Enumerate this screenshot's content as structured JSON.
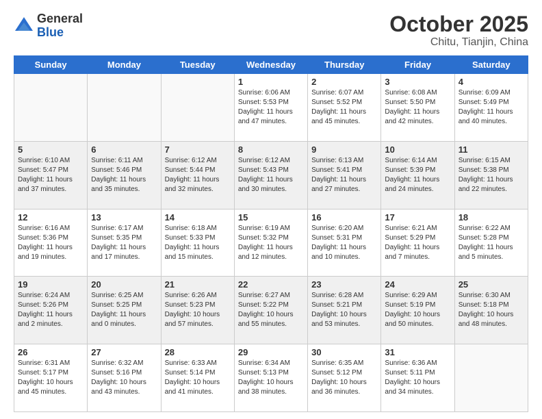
{
  "header": {
    "logo_general": "General",
    "logo_blue": "Blue",
    "month": "October 2025",
    "location": "Chitu, Tianjin, China"
  },
  "weekdays": [
    "Sunday",
    "Monday",
    "Tuesday",
    "Wednesday",
    "Thursday",
    "Friday",
    "Saturday"
  ],
  "weeks": [
    [
      {
        "day": "",
        "info": ""
      },
      {
        "day": "",
        "info": ""
      },
      {
        "day": "",
        "info": ""
      },
      {
        "day": "1",
        "info": "Sunrise: 6:06 AM\nSunset: 5:53 PM\nDaylight: 11 hours\nand 47 minutes."
      },
      {
        "day": "2",
        "info": "Sunrise: 6:07 AM\nSunset: 5:52 PM\nDaylight: 11 hours\nand 45 minutes."
      },
      {
        "day": "3",
        "info": "Sunrise: 6:08 AM\nSunset: 5:50 PM\nDaylight: 11 hours\nand 42 minutes."
      },
      {
        "day": "4",
        "info": "Sunrise: 6:09 AM\nSunset: 5:49 PM\nDaylight: 11 hours\nand 40 minutes."
      }
    ],
    [
      {
        "day": "5",
        "info": "Sunrise: 6:10 AM\nSunset: 5:47 PM\nDaylight: 11 hours\nand 37 minutes."
      },
      {
        "day": "6",
        "info": "Sunrise: 6:11 AM\nSunset: 5:46 PM\nDaylight: 11 hours\nand 35 minutes."
      },
      {
        "day": "7",
        "info": "Sunrise: 6:12 AM\nSunset: 5:44 PM\nDaylight: 11 hours\nand 32 minutes."
      },
      {
        "day": "8",
        "info": "Sunrise: 6:12 AM\nSunset: 5:43 PM\nDaylight: 11 hours\nand 30 minutes."
      },
      {
        "day": "9",
        "info": "Sunrise: 6:13 AM\nSunset: 5:41 PM\nDaylight: 11 hours\nand 27 minutes."
      },
      {
        "day": "10",
        "info": "Sunrise: 6:14 AM\nSunset: 5:39 PM\nDaylight: 11 hours\nand 24 minutes."
      },
      {
        "day": "11",
        "info": "Sunrise: 6:15 AM\nSunset: 5:38 PM\nDaylight: 11 hours\nand 22 minutes."
      }
    ],
    [
      {
        "day": "12",
        "info": "Sunrise: 6:16 AM\nSunset: 5:36 PM\nDaylight: 11 hours\nand 19 minutes."
      },
      {
        "day": "13",
        "info": "Sunrise: 6:17 AM\nSunset: 5:35 PM\nDaylight: 11 hours\nand 17 minutes."
      },
      {
        "day": "14",
        "info": "Sunrise: 6:18 AM\nSunset: 5:33 PM\nDaylight: 11 hours\nand 15 minutes."
      },
      {
        "day": "15",
        "info": "Sunrise: 6:19 AM\nSunset: 5:32 PM\nDaylight: 11 hours\nand 12 minutes."
      },
      {
        "day": "16",
        "info": "Sunrise: 6:20 AM\nSunset: 5:31 PM\nDaylight: 11 hours\nand 10 minutes."
      },
      {
        "day": "17",
        "info": "Sunrise: 6:21 AM\nSunset: 5:29 PM\nDaylight: 11 hours\nand 7 minutes."
      },
      {
        "day": "18",
        "info": "Sunrise: 6:22 AM\nSunset: 5:28 PM\nDaylight: 11 hours\nand 5 minutes."
      }
    ],
    [
      {
        "day": "19",
        "info": "Sunrise: 6:24 AM\nSunset: 5:26 PM\nDaylight: 11 hours\nand 2 minutes."
      },
      {
        "day": "20",
        "info": "Sunrise: 6:25 AM\nSunset: 5:25 PM\nDaylight: 11 hours\nand 0 minutes."
      },
      {
        "day": "21",
        "info": "Sunrise: 6:26 AM\nSunset: 5:23 PM\nDaylight: 10 hours\nand 57 minutes."
      },
      {
        "day": "22",
        "info": "Sunrise: 6:27 AM\nSunset: 5:22 PM\nDaylight: 10 hours\nand 55 minutes."
      },
      {
        "day": "23",
        "info": "Sunrise: 6:28 AM\nSunset: 5:21 PM\nDaylight: 10 hours\nand 53 minutes."
      },
      {
        "day": "24",
        "info": "Sunrise: 6:29 AM\nSunset: 5:19 PM\nDaylight: 10 hours\nand 50 minutes."
      },
      {
        "day": "25",
        "info": "Sunrise: 6:30 AM\nSunset: 5:18 PM\nDaylight: 10 hours\nand 48 minutes."
      }
    ],
    [
      {
        "day": "26",
        "info": "Sunrise: 6:31 AM\nSunset: 5:17 PM\nDaylight: 10 hours\nand 45 minutes."
      },
      {
        "day": "27",
        "info": "Sunrise: 6:32 AM\nSunset: 5:16 PM\nDaylight: 10 hours\nand 43 minutes."
      },
      {
        "day": "28",
        "info": "Sunrise: 6:33 AM\nSunset: 5:14 PM\nDaylight: 10 hours\nand 41 minutes."
      },
      {
        "day": "29",
        "info": "Sunrise: 6:34 AM\nSunset: 5:13 PM\nDaylight: 10 hours\nand 38 minutes."
      },
      {
        "day": "30",
        "info": "Sunrise: 6:35 AM\nSunset: 5:12 PM\nDaylight: 10 hours\nand 36 minutes."
      },
      {
        "day": "31",
        "info": "Sunrise: 6:36 AM\nSunset: 5:11 PM\nDaylight: 10 hours\nand 34 minutes."
      },
      {
        "day": "",
        "info": ""
      }
    ]
  ]
}
